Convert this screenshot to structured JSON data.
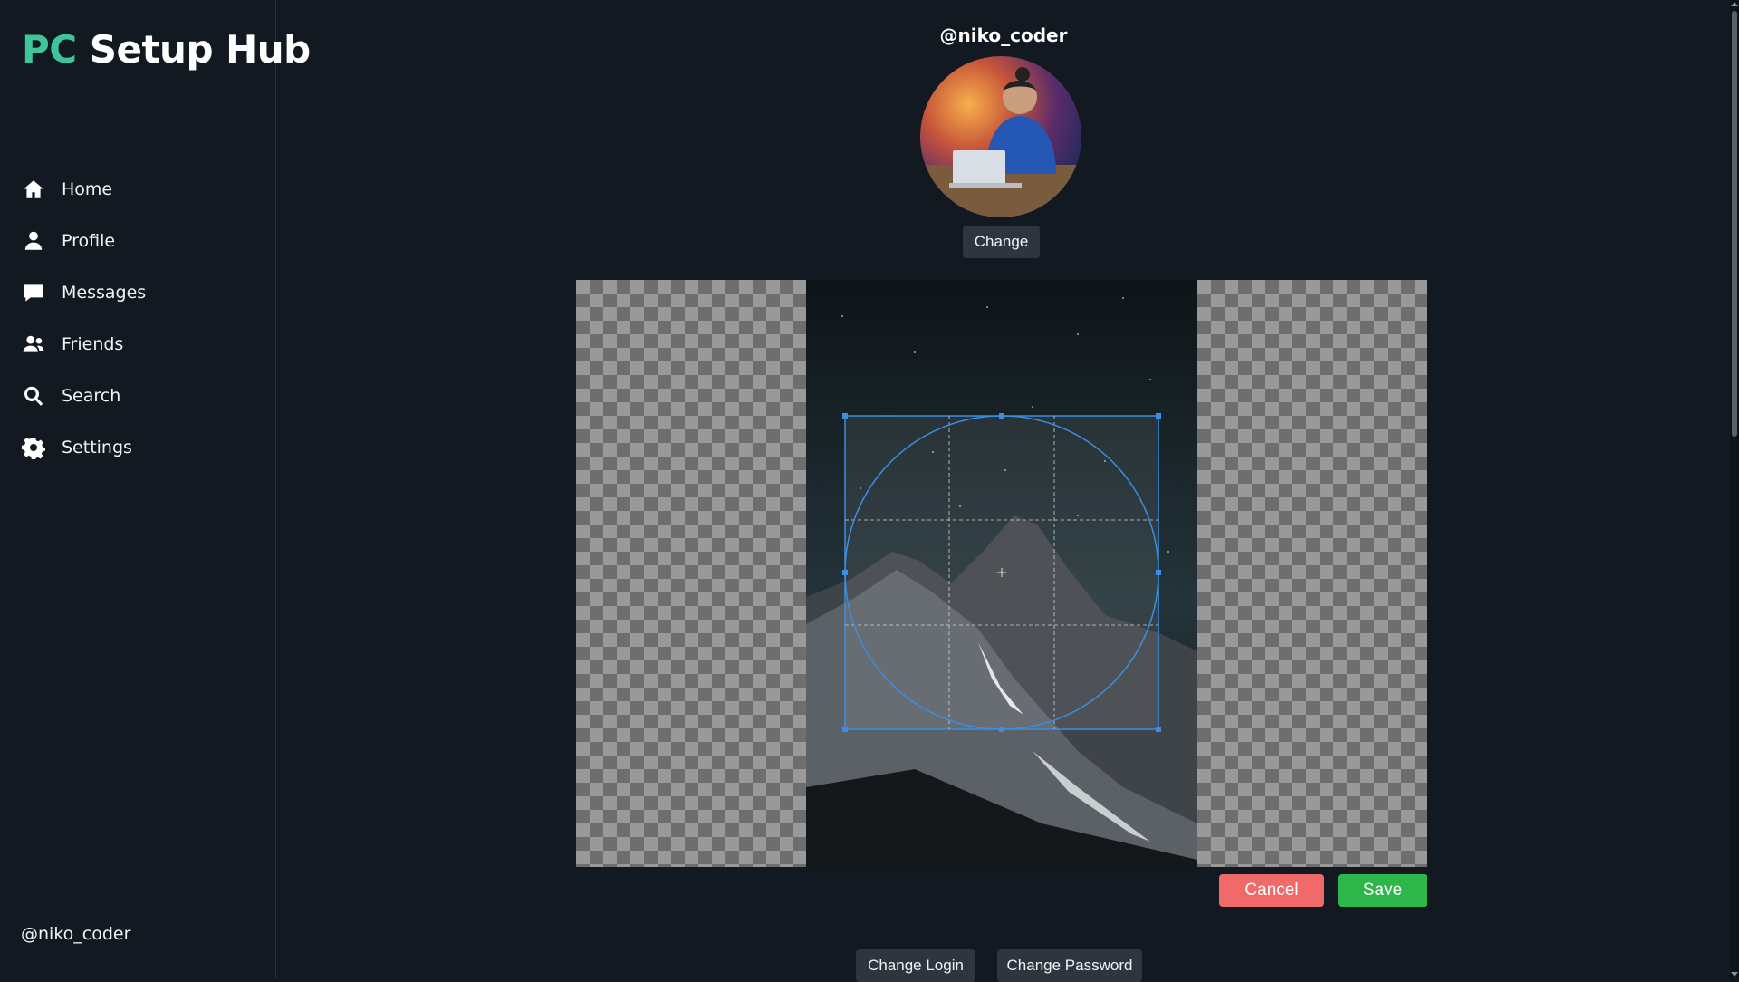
{
  "app": {
    "logo_pc": "PC",
    "logo_rest": " Setup Hub"
  },
  "sidebar": {
    "items": [
      {
        "label": "Home",
        "icon": "home-icon"
      },
      {
        "label": "Profile",
        "icon": "user-icon"
      },
      {
        "label": "Messages",
        "icon": "message-icon"
      },
      {
        "label": "Friends",
        "icon": "friends-icon"
      },
      {
        "label": "Search",
        "icon": "search-icon"
      },
      {
        "label": "Settings",
        "icon": "gear-icon"
      }
    ],
    "user": "@niko_coder"
  },
  "profile": {
    "username": "@niko_coder",
    "change_label": "Change"
  },
  "cropper": {
    "cancel_label": "Cancel",
    "save_label": "Save"
  },
  "account": {
    "change_login_label": "Change Login",
    "change_password_label": "Change Password"
  },
  "colors": {
    "accent": "#3ec69a",
    "cancel": "#f06a6a",
    "save": "#2db74b",
    "crop_border": "#3a8fe0"
  }
}
